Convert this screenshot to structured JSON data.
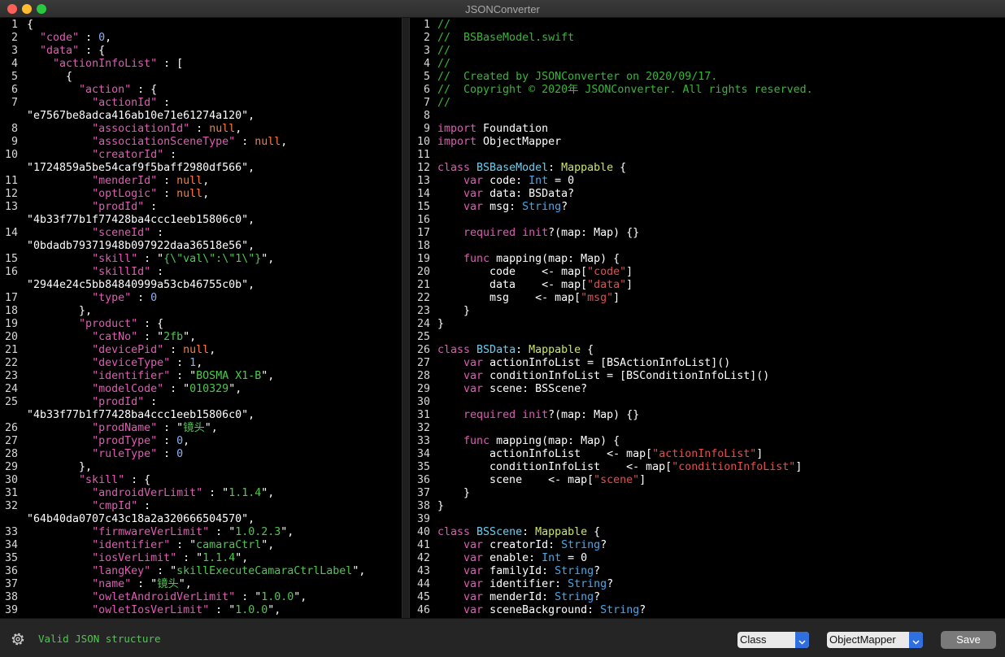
{
  "window": {
    "title": "JSONConverter"
  },
  "left_lines": [
    [
      [
        "p",
        "{"
      ]
    ],
    [
      [
        "p",
        "  "
      ],
      [
        "k",
        "\"code\""
      ],
      [
        "p",
        " : "
      ],
      [
        "n",
        "0"
      ],
      [
        "p",
        ","
      ]
    ],
    [
      [
        "p",
        "  "
      ],
      [
        "k",
        "\"data\""
      ],
      [
        "p",
        " : {"
      ]
    ],
    [
      [
        "p",
        "    "
      ],
      [
        "k",
        "\"actionInfoList\""
      ],
      [
        "p",
        " : ["
      ]
    ],
    [
      [
        "p",
        "      {"
      ]
    ],
    [
      [
        "p",
        "        "
      ],
      [
        "k",
        "\"action\""
      ],
      [
        "p",
        " : {"
      ]
    ],
    [
      [
        "p",
        "          "
      ],
      [
        "k",
        "\"actionId\""
      ],
      [
        "p",
        " :"
      ]
    ],
    [
      [
        "p",
        "\"e7567be8adca416ab10e71e61274a120\","
      ]
    ],
    [
      [
        "p",
        "          "
      ],
      [
        "k",
        "\"associationId\""
      ],
      [
        "p",
        " : "
      ],
      [
        "u",
        "null"
      ],
      [
        "p",
        ","
      ]
    ],
    [
      [
        "p",
        "          "
      ],
      [
        "k",
        "\"associationSceneType\""
      ],
      [
        "p",
        " : "
      ],
      [
        "u",
        "null"
      ],
      [
        "p",
        ","
      ]
    ],
    [
      [
        "p",
        "          "
      ],
      [
        "k",
        "\"creatorId\""
      ],
      [
        "p",
        " :"
      ]
    ],
    [
      [
        "p",
        "\"1724859a5be54caf9f5baff2980df566\","
      ]
    ],
    [
      [
        "p",
        "          "
      ],
      [
        "k",
        "\"menderId\""
      ],
      [
        "p",
        " : "
      ],
      [
        "u",
        "null"
      ],
      [
        "p",
        ","
      ]
    ],
    [
      [
        "p",
        "          "
      ],
      [
        "k",
        "\"optLogic\""
      ],
      [
        "p",
        " : "
      ],
      [
        "u",
        "null"
      ],
      [
        "p",
        ","
      ]
    ],
    [
      [
        "p",
        "          "
      ],
      [
        "k",
        "\"prodId\""
      ],
      [
        "p",
        " :"
      ]
    ],
    [
      [
        "p",
        "\"4b33f77b1f77428ba4ccc1eeb15806c0\","
      ]
    ],
    [
      [
        "p",
        "          "
      ],
      [
        "k",
        "\"sceneId\""
      ],
      [
        "p",
        " :"
      ]
    ],
    [
      [
        "p",
        "\"0bdadb79371948b097922daa36518e56\","
      ]
    ],
    [
      [
        "p",
        "          "
      ],
      [
        "k",
        "\"skill\""
      ],
      [
        "p",
        " : \""
      ],
      [
        "s",
        "{\\\"val\\\":\\\"1\\\"}"
      ],
      [
        "p",
        "\","
      ]
    ],
    [
      [
        "p",
        "          "
      ],
      [
        "k",
        "\"skillId\""
      ],
      [
        "p",
        " :"
      ]
    ],
    [
      [
        "p",
        "\"2944e24c5bb84840999a53cb46755c0b\","
      ]
    ],
    [
      [
        "p",
        "          "
      ],
      [
        "k",
        "\"type\""
      ],
      [
        "p",
        " : "
      ],
      [
        "n",
        "0"
      ]
    ],
    [
      [
        "p",
        "        },"
      ]
    ],
    [
      [
        "p",
        "        "
      ],
      [
        "k",
        "\"product\""
      ],
      [
        "p",
        " : {"
      ]
    ],
    [
      [
        "p",
        "          "
      ],
      [
        "k",
        "\"catNo\""
      ],
      [
        "p",
        " : \""
      ],
      [
        "s",
        "2fb"
      ],
      [
        "p",
        "\","
      ]
    ],
    [
      [
        "p",
        "          "
      ],
      [
        "k",
        "\"devicePid\""
      ],
      [
        "p",
        " : "
      ],
      [
        "u",
        "null"
      ],
      [
        "p",
        ","
      ]
    ],
    [
      [
        "p",
        "          "
      ],
      [
        "k",
        "\"deviceType\""
      ],
      [
        "p",
        " : "
      ],
      [
        "n",
        "1"
      ],
      [
        "p",
        ","
      ]
    ],
    [
      [
        "p",
        "          "
      ],
      [
        "k",
        "\"identifier\""
      ],
      [
        "p",
        " : \""
      ],
      [
        "s",
        "BOSMA X1-B"
      ],
      [
        "p",
        "\","
      ]
    ],
    [
      [
        "p",
        "          "
      ],
      [
        "k",
        "\"modelCode\""
      ],
      [
        "p",
        " : \""
      ],
      [
        "s",
        "010329"
      ],
      [
        "p",
        "\","
      ]
    ],
    [
      [
        "p",
        "          "
      ],
      [
        "k",
        "\"prodId\""
      ],
      [
        "p",
        " :"
      ]
    ],
    [
      [
        "p",
        "\"4b33f77b1f77428ba4ccc1eeb15806c0\","
      ]
    ],
    [
      [
        "p",
        "          "
      ],
      [
        "k",
        "\"prodName\""
      ],
      [
        "p",
        " : \""
      ],
      [
        "s",
        "镜头"
      ],
      [
        "p",
        "\","
      ]
    ],
    [
      [
        "p",
        "          "
      ],
      [
        "k",
        "\"prodType\""
      ],
      [
        "p",
        " : "
      ],
      [
        "n",
        "0"
      ],
      [
        "p",
        ","
      ]
    ],
    [
      [
        "p",
        "          "
      ],
      [
        "k",
        "\"ruleType\""
      ],
      [
        "p",
        " : "
      ],
      [
        "n",
        "0"
      ]
    ],
    [
      [
        "p",
        "        },"
      ]
    ],
    [
      [
        "p",
        "        "
      ],
      [
        "k",
        "\"skill\""
      ],
      [
        "p",
        " : {"
      ]
    ],
    [
      [
        "p",
        "          "
      ],
      [
        "k",
        "\"androidVerLimit\""
      ],
      [
        "p",
        " : \""
      ],
      [
        "s",
        "1.1.4"
      ],
      [
        "p",
        "\","
      ]
    ],
    [
      [
        "p",
        "          "
      ],
      [
        "k",
        "\"cmpId\""
      ],
      [
        "p",
        " :"
      ]
    ],
    [
      [
        "p",
        "\"64b40da0707c43c18a2a320666504570\","
      ]
    ],
    [
      [
        "p",
        "          "
      ],
      [
        "k",
        "\"firmwareVerLimit\""
      ],
      [
        "p",
        " : \""
      ],
      [
        "s",
        "1.0.2.3"
      ],
      [
        "p",
        "\","
      ]
    ],
    [
      [
        "p",
        "          "
      ],
      [
        "k",
        "\"identifier\""
      ],
      [
        "p",
        " : \""
      ],
      [
        "s",
        "camaraCtrl"
      ],
      [
        "p",
        "\","
      ]
    ],
    [
      [
        "p",
        "          "
      ],
      [
        "k",
        "\"iosVerLimit\""
      ],
      [
        "p",
        " : \""
      ],
      [
        "s",
        "1.1.4"
      ],
      [
        "p",
        "\","
      ]
    ],
    [
      [
        "p",
        "          "
      ],
      [
        "k",
        "\"langKey\""
      ],
      [
        "p",
        " : \""
      ],
      [
        "s",
        "skillExecuteCamaraCtrlLabel"
      ],
      [
        "p",
        "\","
      ]
    ],
    [
      [
        "p",
        "          "
      ],
      [
        "k",
        "\"name\""
      ],
      [
        "p",
        " : \""
      ],
      [
        "s",
        "镜头"
      ],
      [
        "p",
        "\","
      ]
    ],
    [
      [
        "p",
        "          "
      ],
      [
        "k",
        "\"owletAndroidVerLimit\""
      ],
      [
        "p",
        " : \""
      ],
      [
        "s",
        "1.0.0"
      ],
      [
        "p",
        "\","
      ]
    ],
    [
      [
        "p",
        "          "
      ],
      [
        "k",
        "\"owletIosVerLimit\""
      ],
      [
        "p",
        " : \""
      ],
      [
        "s",
        "1.0.0"
      ],
      [
        "p",
        "\","
      ]
    ]
  ],
  "left_numbers": [
    "1",
    "2",
    "3",
    "4",
    "5",
    "6",
    "7",
    "",
    "8",
    "9",
    "10",
    "",
    "11",
    "12",
    "13",
    "",
    "14",
    "",
    "15",
    "16",
    "",
    "17",
    "18",
    "19",
    "20",
    "21",
    "22",
    "23",
    "24",
    "25",
    "",
    "26",
    "27",
    "28",
    "29",
    "30",
    "31",
    "32",
    "",
    "33",
    "34",
    "35",
    "36",
    "37",
    "38",
    "39"
  ],
  "right_lines": [
    [
      [
        "c",
        "//"
      ]
    ],
    [
      [
        "c",
        "//  BSBaseModel.swift"
      ]
    ],
    [
      [
        "c",
        "//"
      ]
    ],
    [
      [
        "c",
        "//"
      ]
    ],
    [
      [
        "c",
        "//  Created by JSONConverter on 2020/09/17."
      ]
    ],
    [
      [
        "c",
        "//  Copyright © 2020年 JSONConverter. All rights reserved."
      ]
    ],
    [
      [
        "c",
        "//"
      ]
    ],
    [
      [
        "p",
        ""
      ]
    ],
    [
      [
        "kw",
        "import"
      ],
      [
        "p",
        " Foundation"
      ]
    ],
    [
      [
        "kw",
        "import"
      ],
      [
        "p",
        " ObjectMapper"
      ]
    ],
    [
      [
        "p",
        ""
      ]
    ],
    [
      [
        "kw",
        "class"
      ],
      [
        "p",
        " "
      ],
      [
        "cls",
        "BSBaseModel"
      ],
      [
        "p",
        ": "
      ],
      [
        "t",
        "Mappable"
      ],
      [
        "p",
        " {"
      ]
    ],
    [
      [
        "p",
        "    "
      ],
      [
        "kw",
        "var"
      ],
      [
        "p",
        " code: "
      ],
      [
        "ty",
        "Int"
      ],
      [
        "p",
        " = 0"
      ]
    ],
    [
      [
        "p",
        "    "
      ],
      [
        "kw",
        "var"
      ],
      [
        "p",
        " data: BSData?"
      ]
    ],
    [
      [
        "p",
        "    "
      ],
      [
        "kw",
        "var"
      ],
      [
        "p",
        " msg: "
      ],
      [
        "ty",
        "String"
      ],
      [
        "p",
        "?"
      ]
    ],
    [
      [
        "p",
        ""
      ]
    ],
    [
      [
        "p",
        "    "
      ],
      [
        "kw",
        "required"
      ],
      [
        "p",
        " "
      ],
      [
        "kw",
        "init"
      ],
      [
        "p",
        "?(map: Map) {}"
      ]
    ],
    [
      [
        "p",
        ""
      ]
    ],
    [
      [
        "p",
        "    "
      ],
      [
        "kw",
        "func"
      ],
      [
        "p",
        " mapping(map: Map) {"
      ]
    ],
    [
      [
        "p",
        "        code    <- map["
      ],
      [
        "str",
        "\"code\""
      ],
      [
        "p",
        "]"
      ]
    ],
    [
      [
        "p",
        "        data    <- map["
      ],
      [
        "str",
        "\"data\""
      ],
      [
        "p",
        "]"
      ]
    ],
    [
      [
        "p",
        "        msg    <- map["
      ],
      [
        "str",
        "\"msg\""
      ],
      [
        "p",
        "]"
      ]
    ],
    [
      [
        "p",
        "    }"
      ]
    ],
    [
      [
        "p",
        "}"
      ]
    ],
    [
      [
        "p",
        ""
      ]
    ],
    [
      [
        "kw",
        "class"
      ],
      [
        "p",
        " "
      ],
      [
        "cls",
        "BSData"
      ],
      [
        "p",
        ": "
      ],
      [
        "t",
        "Mappable"
      ],
      [
        "p",
        " {"
      ]
    ],
    [
      [
        "p",
        "    "
      ],
      [
        "kw",
        "var"
      ],
      [
        "p",
        " actionInfoList = [BSActionInfoList]()"
      ]
    ],
    [
      [
        "p",
        "    "
      ],
      [
        "kw",
        "var"
      ],
      [
        "p",
        " conditionInfoList = [BSConditionInfoList]()"
      ]
    ],
    [
      [
        "p",
        "    "
      ],
      [
        "kw",
        "var"
      ],
      [
        "p",
        " scene: BSScene?"
      ]
    ],
    [
      [
        "p",
        ""
      ]
    ],
    [
      [
        "p",
        "    "
      ],
      [
        "kw",
        "required"
      ],
      [
        "p",
        " "
      ],
      [
        "kw",
        "init"
      ],
      [
        "p",
        "?(map: Map) {}"
      ]
    ],
    [
      [
        "p",
        ""
      ]
    ],
    [
      [
        "p",
        "    "
      ],
      [
        "kw",
        "func"
      ],
      [
        "p",
        " mapping(map: Map) {"
      ]
    ],
    [
      [
        "p",
        "        actionInfoList    <- map["
      ],
      [
        "str",
        "\"actionInfoList\""
      ],
      [
        "p",
        "]"
      ]
    ],
    [
      [
        "p",
        "        conditionInfoList    <- map["
      ],
      [
        "str",
        "\"conditionInfoList\""
      ],
      [
        "p",
        "]"
      ]
    ],
    [
      [
        "p",
        "        scene    <- map["
      ],
      [
        "str",
        "\"scene\""
      ],
      [
        "p",
        "]"
      ]
    ],
    [
      [
        "p",
        "    }"
      ]
    ],
    [
      [
        "p",
        "}"
      ]
    ],
    [
      [
        "p",
        ""
      ]
    ],
    [
      [
        "kw",
        "class"
      ],
      [
        "p",
        " "
      ],
      [
        "cls",
        "BSScene"
      ],
      [
        "p",
        ": "
      ],
      [
        "t",
        "Mappable"
      ],
      [
        "p",
        " {"
      ]
    ],
    [
      [
        "p",
        "    "
      ],
      [
        "kw",
        "var"
      ],
      [
        "p",
        " creatorId: "
      ],
      [
        "ty",
        "String"
      ],
      [
        "p",
        "?"
      ]
    ],
    [
      [
        "p",
        "    "
      ],
      [
        "kw",
        "var"
      ],
      [
        "p",
        " enable: "
      ],
      [
        "ty",
        "Int"
      ],
      [
        "p",
        " = 0"
      ]
    ],
    [
      [
        "p",
        "    "
      ],
      [
        "kw",
        "var"
      ],
      [
        "p",
        " familyId: "
      ],
      [
        "ty",
        "String"
      ],
      [
        "p",
        "?"
      ]
    ],
    [
      [
        "p",
        "    "
      ],
      [
        "kw",
        "var"
      ],
      [
        "p",
        " identifier: "
      ],
      [
        "ty",
        "String"
      ],
      [
        "p",
        "?"
      ]
    ],
    [
      [
        "p",
        "    "
      ],
      [
        "kw",
        "var"
      ],
      [
        "p",
        " menderId: "
      ],
      [
        "ty",
        "String"
      ],
      [
        "p",
        "?"
      ]
    ],
    [
      [
        "p",
        "    "
      ],
      [
        "kw",
        "var"
      ],
      [
        "p",
        " sceneBackground: "
      ],
      [
        "ty",
        "String"
      ],
      [
        "p",
        "?"
      ]
    ]
  ],
  "right_numbers": [
    "1",
    "2",
    "3",
    "4",
    "5",
    "6",
    "7",
    "8",
    "9",
    "10",
    "11",
    "12",
    "13",
    "14",
    "15",
    "16",
    "17",
    "18",
    "19",
    "20",
    "21",
    "22",
    "23",
    "24",
    "25",
    "26",
    "27",
    "28",
    "29",
    "30",
    "31",
    "32",
    "33",
    "34",
    "35",
    "36",
    "37",
    "38",
    "39",
    "40",
    "41",
    "42",
    "43",
    "44",
    "45",
    "46"
  ],
  "status": {
    "message": "Valid JSON structure",
    "icon": "gear-icon"
  },
  "controls": {
    "structure_select": "Class",
    "framework_select": "ObjectMapper",
    "save_label": "Save"
  },
  "colors": {
    "json_key": "#e25bb5",
    "json_string": "#4ec94e",
    "json_number": "#8ab4f8",
    "json_null": "#ff7a3d",
    "comment": "#38b738",
    "keyword": "#e25bb5",
    "class_name": "#66d0f5",
    "protocol": "#c8e85c",
    "builtin_type": "#4aa8e8",
    "string_literal": "#e14f4f",
    "select_accent": "#2f6fe0"
  }
}
